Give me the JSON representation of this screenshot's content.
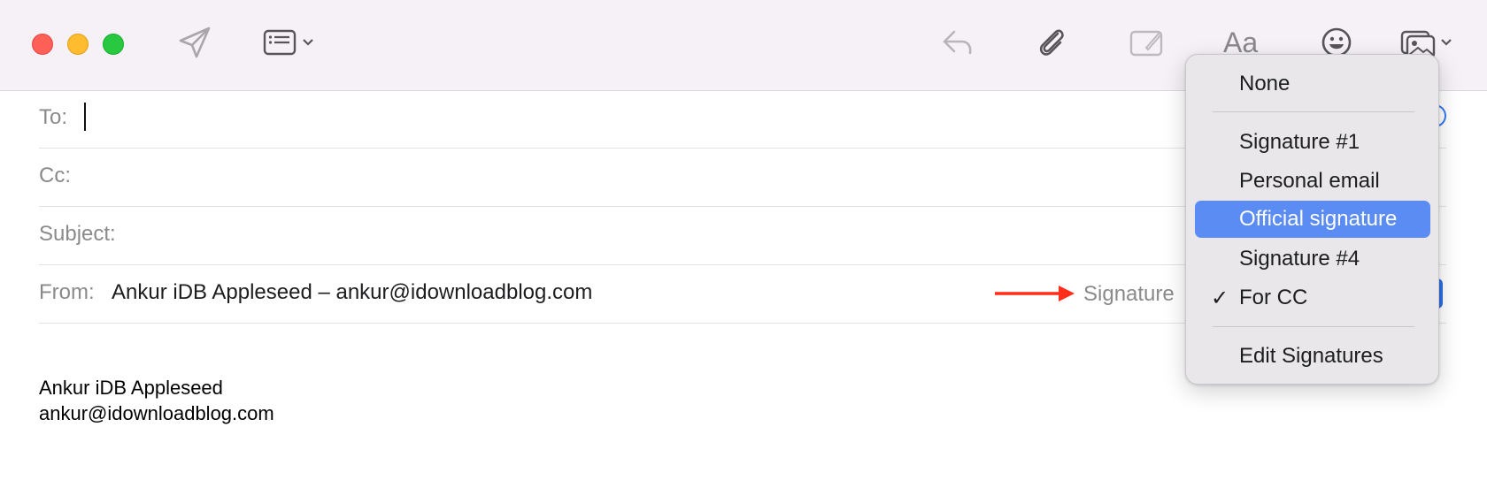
{
  "window": {
    "toolbar": {
      "traffic_lights": {
        "close": "#fe5f57",
        "minimize": "#febc2e",
        "maximize": "#28c840"
      },
      "icons": [
        "paper-plane-icon",
        "header-fields-icon",
        "chevron-down-icon",
        "reply-icon",
        "paperclip-icon",
        "markup-icon",
        "format-icon",
        "emoji-icon",
        "photo-browser-icon",
        "chevron-down-icon"
      ],
      "format_label": "Aa"
    }
  },
  "fields": {
    "to_label": "To:",
    "cc_label": "Cc:",
    "subject_label": "Subject:",
    "from_label": "From:",
    "from_value": "Ankur iDB Appleseed – ankur@idownloadblog.com",
    "signature_label": "Signature"
  },
  "body": {
    "signature_name": "Ankur iDB Appleseed",
    "signature_email": "ankur@idownloadblog.com"
  },
  "signature_menu": {
    "items": [
      {
        "label": "None",
        "selected": false,
        "checked": false
      },
      {
        "label": "Signature #1",
        "selected": false,
        "checked": false
      },
      {
        "label": "Personal email",
        "selected": false,
        "checked": false
      },
      {
        "label": "Official signature",
        "selected": true,
        "checked": false
      },
      {
        "label": "Signature #4",
        "selected": false,
        "checked": false
      },
      {
        "label": "For CC",
        "selected": false,
        "checked": true
      },
      {
        "label": "Edit Signatures",
        "selected": false,
        "checked": false
      }
    ],
    "check_glyph": "✓",
    "highlight_color": "#5b8cf4"
  },
  "annotation": {
    "arrow_color": "#ff2d1a"
  }
}
